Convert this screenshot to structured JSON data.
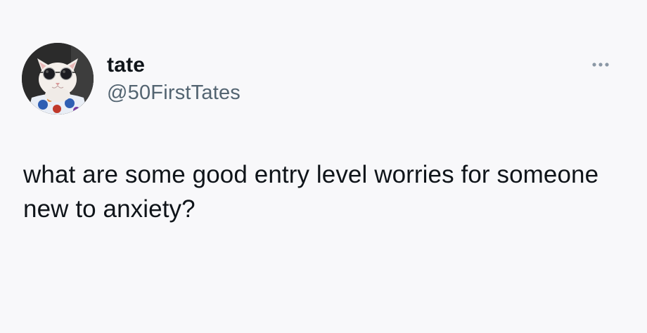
{
  "tweet": {
    "author": {
      "display_name": "tate",
      "handle": "@50FirstTates",
      "avatar_icon": "cat-with-sunglasses-avatar"
    },
    "more_icon": "more-horizontal-icon",
    "text": "what are some good entry level worries for someone new to anxiety?"
  },
  "colors": {
    "background": "#f8f8fa",
    "text_primary": "#0f1419",
    "text_secondary": "#536471"
  }
}
